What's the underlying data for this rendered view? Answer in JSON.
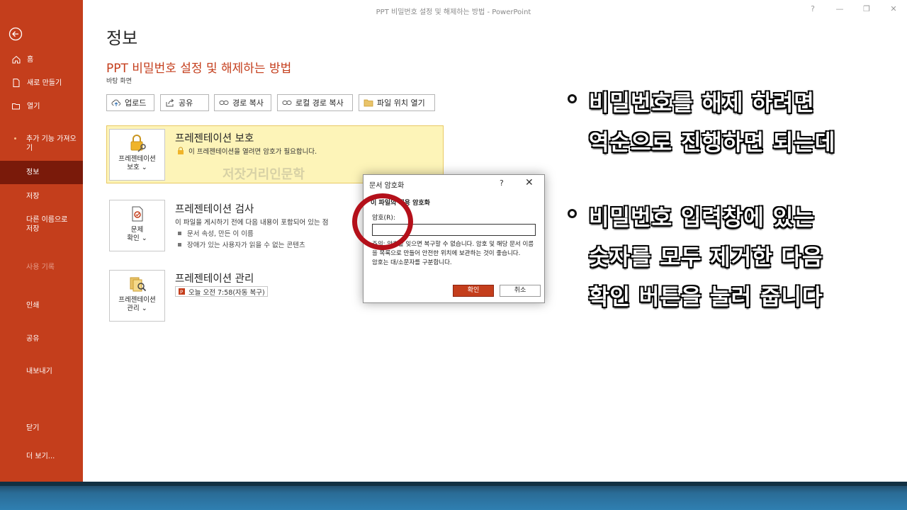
{
  "window": {
    "title": "PPT 비밀번호 설정 및 해제하는 방법  -  PowerPoint",
    "help": "?",
    "minimize": "—",
    "restore": "❐",
    "close": "✕"
  },
  "sidebar": {
    "items": [
      {
        "label": "홈",
        "icon": "home-icon"
      },
      {
        "label": "새로 만들기",
        "icon": "new-document-icon"
      },
      {
        "label": "열기",
        "icon": "folder-open-icon"
      },
      {
        "label": "추가 기능 가져오기"
      },
      {
        "label": "정보",
        "active": true
      },
      {
        "label": "저장"
      },
      {
        "label": "다른 이름으로 저장"
      },
      {
        "label": "사용 기록",
        "disabled": true
      },
      {
        "label": "인쇄"
      },
      {
        "label": "공유"
      },
      {
        "label": "내보내기"
      },
      {
        "label": "닫기"
      },
      {
        "label": "더 보기..."
      }
    ]
  },
  "page": {
    "title": "정보",
    "doc_title": "PPT 비밀번호 설정 및 해제하는 방법",
    "doc_location": "바탕 화면"
  },
  "toolbar": {
    "upload": "업로드",
    "share": "공유",
    "copy_path": "경로 복사",
    "copy_local_path": "로컬 경로 복사",
    "open_location": "파일 위치 열기"
  },
  "protect": {
    "button_line1": "프레젠테이션",
    "button_line2": "보호 ⌄",
    "heading": "프레젠테이션 보호",
    "desc": "이 프레젠테이션을 열려면 암호가 필요합니다."
  },
  "inspect": {
    "button_line1": "문제",
    "button_line2": "확인 ⌄",
    "heading": "프레젠테이션 검사",
    "desc": "이 파일을 게시하기 전에 다음 내용이 포함되어 있는 점",
    "bullets": [
      "문서 속성, 만든 이 이름",
      "장애가 있는 사용자가 읽을 수 없는 콘텐츠"
    ]
  },
  "manage": {
    "button_line1": "프레젠테이션",
    "button_line2": "관리 ⌄",
    "heading": "프레젠테이션 관리",
    "version": "오늘 오전 7:58(자동 복구)"
  },
  "watermark": "저잣거리인문학",
  "dialog": {
    "title": "문서 암호화",
    "help": "?",
    "close": "✕",
    "section": "이 파일의 내용 암호화",
    "password_label": "암호(R):",
    "password_value": "",
    "warning": "주의: 암호를 잊으면 복구할 수 없습니다. 암호 및 해당 문서 이름을 목록으로 만들어 안전한 위치에 보관하는 것이 좋습니다.",
    "case_note": "암호는 대/소문자를 구분합니다.",
    "ok": "확인",
    "cancel": "취소"
  },
  "annotations": {
    "first": [
      "비밀번호를 해제 하려면",
      "역순으로 진행하면 되는데"
    ],
    "second": [
      "비밀번호 입력창에 있는",
      "숫자를 모두 제거한 다음",
      "확인 버튼을 눌러 줍니다"
    ]
  },
  "colors": {
    "accent": "#c43e1c",
    "sidebar_active": "#7a1a0a",
    "highlight": "#fdf4b8",
    "circle": "#b4101a"
  }
}
